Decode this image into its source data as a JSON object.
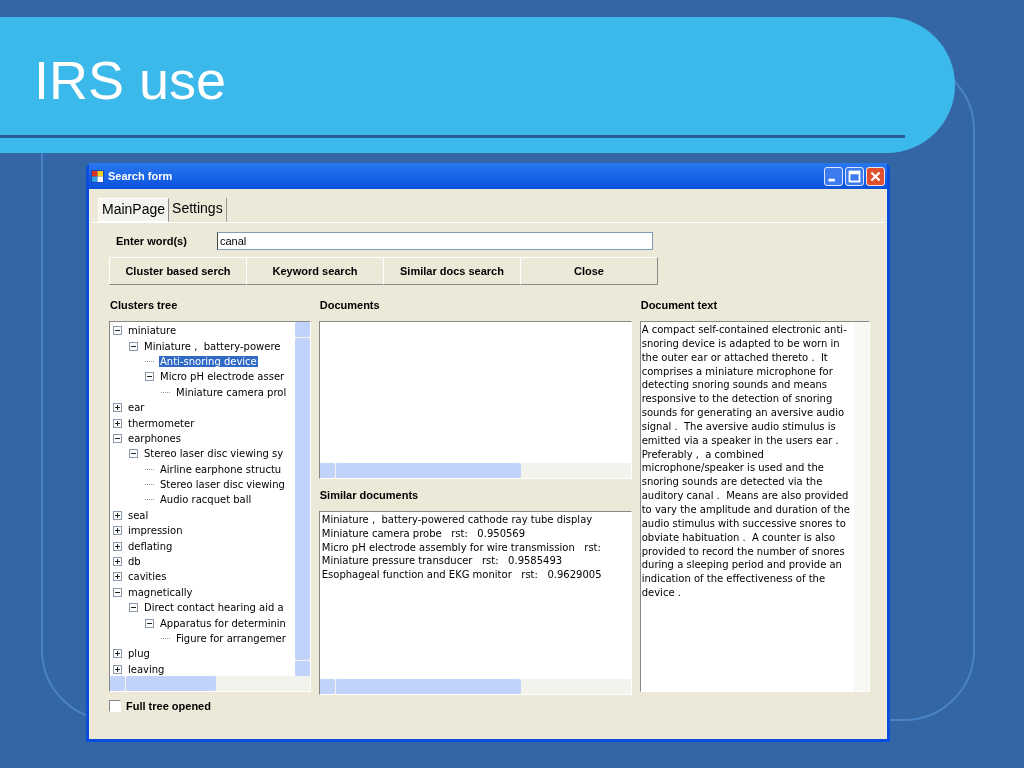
{
  "slide": {
    "title": "IRS use"
  },
  "window": {
    "title": "Search form",
    "tabs": [
      {
        "label": "MainPage",
        "selected": true
      },
      {
        "label": "Settings",
        "selected": false
      }
    ],
    "query": {
      "label": "Enter word(s)",
      "value": "canal"
    },
    "buttons": [
      "Cluster based serch",
      "Keyword search",
      "Similar docs search",
      "Close"
    ],
    "clusters_tree": {
      "heading": "Clusters tree",
      "items": [
        {
          "label": "miniature",
          "expanded": true,
          "selected": false,
          "children": [
            {
              "label": "Miniature ,  battery-powere",
              "expanded": true,
              "selected": false,
              "children": [
                {
                  "label": "Anti-snoring device",
                  "selected": true
                },
                {
                  "label": "Micro pH electrode asser",
                  "expanded": true,
                  "selected": false,
                  "children": [
                    {
                      "label": "Miniature camera prol",
                      "selected": false
                    }
                  ]
                }
              ]
            }
          ]
        },
        {
          "label": "ear",
          "expanded": false,
          "selected": false
        },
        {
          "label": "thermometer",
          "expanded": false,
          "selected": false
        },
        {
          "label": "earphones",
          "expanded": true,
          "selected": false,
          "children": [
            {
              "label": "Stereo laser disc viewing sy",
              "expanded": true,
              "selected": false,
              "children": [
                {
                  "label": "Airline earphone structu",
                  "selected": false
                },
                {
                  "label": "Stereo laser disc viewing",
                  "selected": false
                },
                {
                  "label": "Audio racquet ball",
                  "selected": false
                }
              ]
            }
          ]
        },
        {
          "label": "seal",
          "expanded": false,
          "selected": false
        },
        {
          "label": "impression",
          "expanded": false,
          "selected": false
        },
        {
          "label": "deflating",
          "expanded": false,
          "selected": false
        },
        {
          "label": "db",
          "expanded": false,
          "selected": false
        },
        {
          "label": "cavities",
          "expanded": false,
          "selected": false
        },
        {
          "label": "magnetically",
          "expanded": true,
          "selected": false,
          "children": [
            {
              "label": "Direct contact hearing aid a",
              "expanded": true,
              "selected": false,
              "children": [
                {
                  "label": "Apparatus for determinin",
                  "expanded": true,
                  "selected": false,
                  "children": [
                    {
                      "label": "Figure for arrangemer",
                      "selected": false
                    }
                  ]
                }
              ]
            }
          ]
        },
        {
          "label": "plug",
          "expanded": false,
          "selected": false
        },
        {
          "label": "leaving",
          "expanded": false,
          "selected": false
        }
      ]
    },
    "documents": {
      "heading": "Documents"
    },
    "similar_documents": {
      "heading": "Similar documents",
      "rows": [
        "Miniature ,  battery-powered cathode ray tube display",
        "Miniature camera probe   rst:   0.950569",
        "Micro pH electrode assembly for wire transmission   rst:",
        "Miniature pressure transducer   rst:   0.9585493",
        "Esophageal function and EKG monitor   rst:   0.9629005"
      ]
    },
    "document_text": {
      "heading": "Document text",
      "text": "A compact self-contained electronic anti-snoring device is adapted to be worn in the outer ear or attached thereto .  It comprises a miniature microphone for detecting snoring sounds and means responsive to the detection of snoring sounds for generating an aversive audio signal .  The aversive audio stimulus is emitted via a speaker in the users ear .  Preferably ,  a combined microphone/speaker is used and the snoring sounds are detected via the auditory canal .  Means are also provided to vary the amplitude and duration of the audio stimulus with successive snores to obviate habituation .  A counter is also provided to record the number of snores during a sleeping period and provide an indication of the effectiveness of the device ."
    },
    "full_tree_opened": {
      "label": "Full tree opened",
      "checked": false
    }
  }
}
